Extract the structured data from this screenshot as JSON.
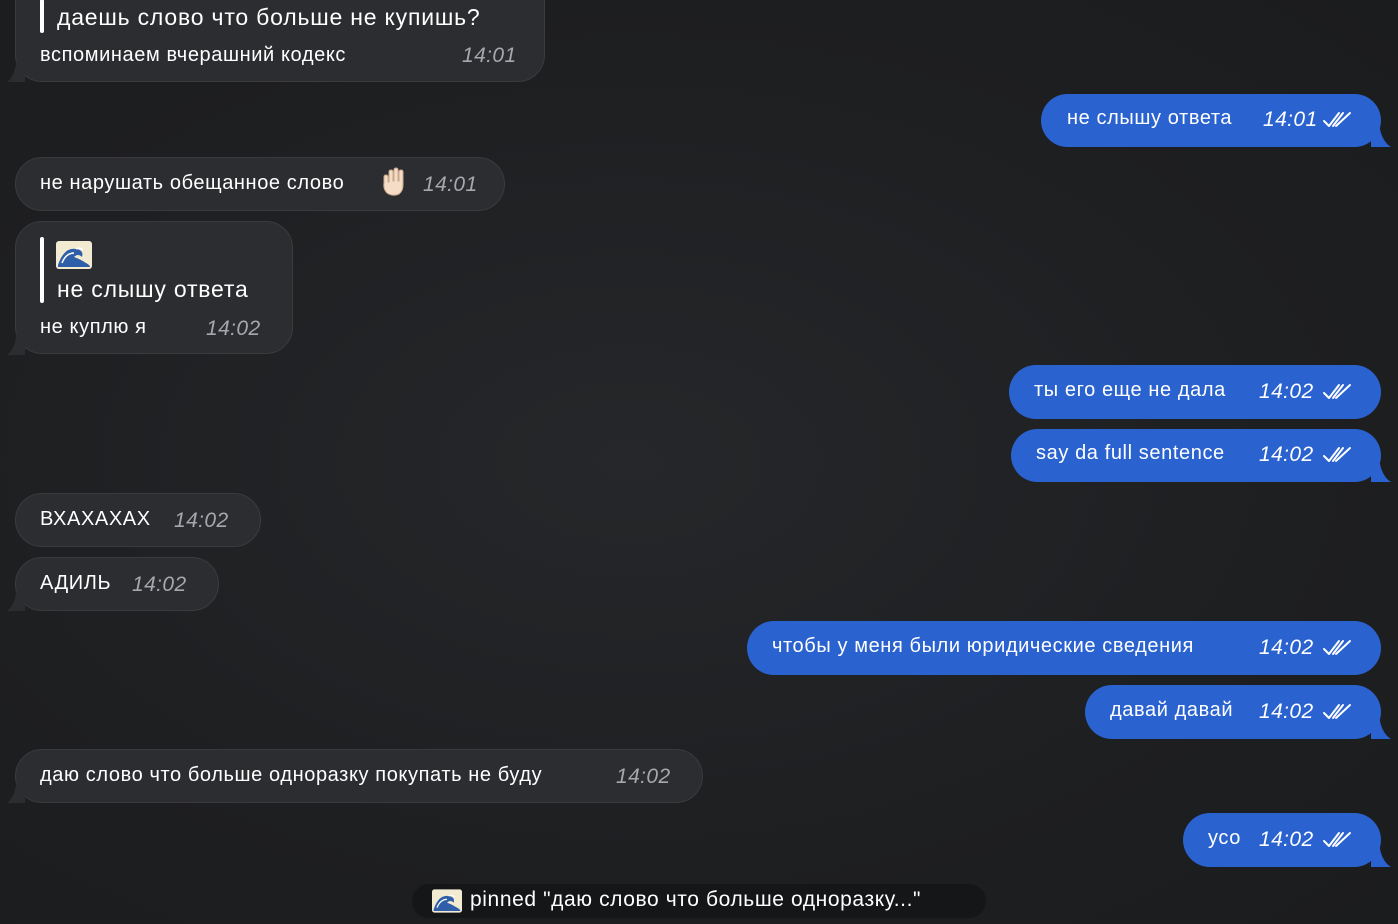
{
  "messages": [
    {
      "id": 1,
      "direction": "in",
      "quote": "даешь слово что больше не купишь?",
      "text": "вспоминаем вчерашний кодекс",
      "time": "14:01"
    },
    {
      "id": 2,
      "direction": "out",
      "text": "не слышу ответа",
      "time": "14:01",
      "status": "read"
    },
    {
      "id": 3,
      "direction": "in",
      "text": "не нарушать обещанное слово",
      "emoji": "raised-hand",
      "time": "14:01"
    },
    {
      "id": 4,
      "direction": "in",
      "quote_author_icon": "wave-emoji",
      "quote": "не слышу ответа",
      "text": "не куплю я",
      "time": "14:02"
    },
    {
      "id": 5,
      "direction": "out",
      "text": "ты его еще не дала",
      "time": "14:02",
      "status": "read"
    },
    {
      "id": 6,
      "direction": "out",
      "text": "say da full sentence",
      "time": "14:02",
      "status": "read"
    },
    {
      "id": 7,
      "direction": "in",
      "text": "ВХАХАХАХ",
      "time": "14:02"
    },
    {
      "id": 8,
      "direction": "in",
      "text": "АДИЛЬ",
      "time": "14:02"
    },
    {
      "id": 9,
      "direction": "out",
      "text": "чтобы у меня были юридические сведения",
      "time": "14:02",
      "status": "read"
    },
    {
      "id": 10,
      "direction": "out",
      "text": "давай давай",
      "time": "14:02",
      "status": "read"
    },
    {
      "id": 11,
      "direction": "in",
      "text": "даю слово что больше одноразку покупать не буду",
      "time": "14:02"
    },
    {
      "id": 12,
      "direction": "out",
      "text": "усо",
      "time": "14:02",
      "status": "read"
    }
  ],
  "pinned": {
    "icon": "wave-emoji",
    "text": "pinned \"даю слово что больше одноразку...\""
  },
  "colors": {
    "background": "#1f2022",
    "incoming_bubble": "#2c2d30",
    "outgoing_bubble": "#2a62d0",
    "incoming_time": "#a6a8ad"
  }
}
